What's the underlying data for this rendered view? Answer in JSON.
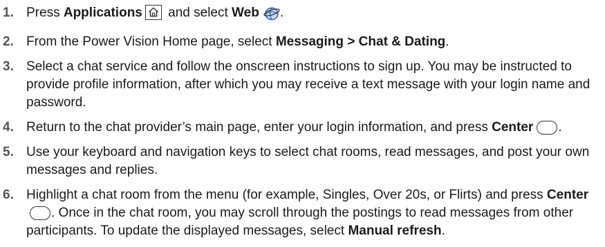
{
  "steps": [
    {
      "number": "1.",
      "parts": {
        "t1": "Press ",
        "b1": "Applications",
        "t2": " and select ",
        "b2": "Web",
        "t3": "."
      }
    },
    {
      "number": "2.",
      "parts": {
        "t1": "From the Power Vision Home page, select ",
        "b1": "Messaging > Chat & Dating",
        "t2": "."
      }
    },
    {
      "number": "3.",
      "parts": {
        "t1": "Select a chat service and follow the onscreen instructions to sign up. You may be instructed to provide profile information, after which you may receive a text message with your login name and password."
      }
    },
    {
      "number": "4.",
      "parts": {
        "t1": "Return to the chat provider’s main page, enter your login information, and press ",
        "b1": "Center",
        "t2": "."
      }
    },
    {
      "number": "5.",
      "parts": {
        "t1": "Use your keyboard and navigation keys to select chat rooms, read messages, and post your own messages and replies."
      }
    },
    {
      "number": "6.",
      "parts": {
        "t1": "Highlight a chat room from the menu (for example, Singles, Over 20s, or Flirts) and press ",
        "b1": "Center",
        "t2": ". Once in the chat room, you may scroll through the postings to read messages from other participants. To update the displayed messages, select ",
        "b2": "Manual refresh",
        "t3": "."
      }
    }
  ],
  "icons": {
    "applications_key": "home-key-icon",
    "web": "web-globe-icon",
    "center_key": "center-key-icon"
  },
  "colors": {
    "text": "#1a1a1a",
    "step_number": "#555555",
    "web_icon_blue": "#2a62b8"
  }
}
